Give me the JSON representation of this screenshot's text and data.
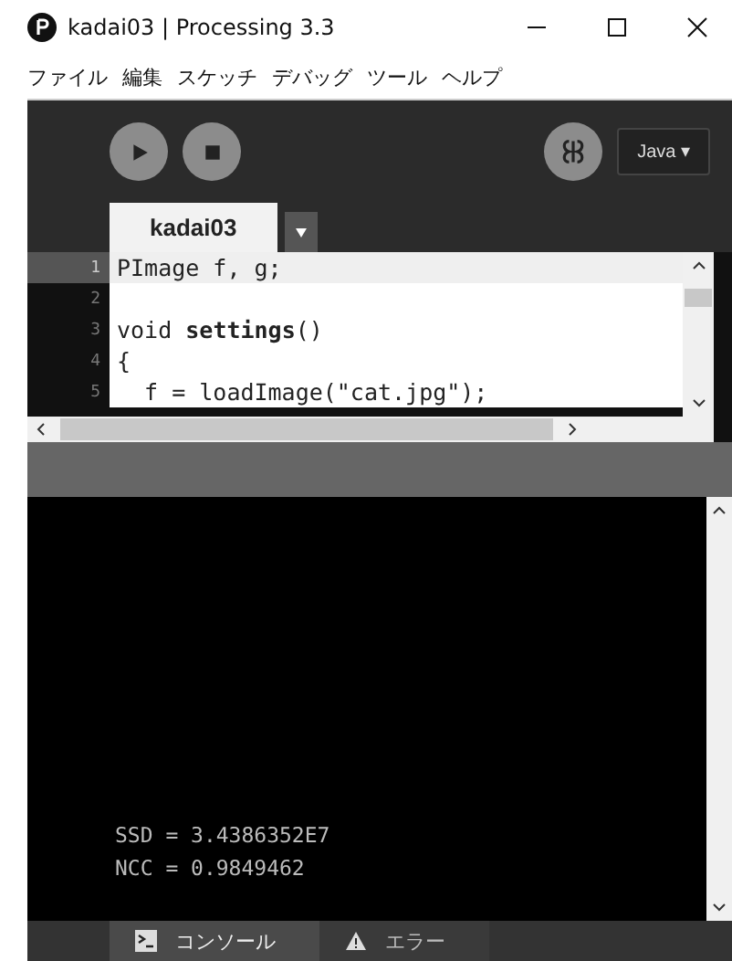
{
  "window": {
    "title": "kadai03 | Processing 3.3"
  },
  "menu": [
    "ファイル",
    "編集",
    "スケッチ",
    "デバッグ",
    "ツール",
    "ヘルプ"
  ],
  "toolbar": {
    "mode": "Java ▾"
  },
  "tabs": [
    {
      "label": "kadai03",
      "selected": true
    }
  ],
  "editor": {
    "lines": [
      {
        "number": "1",
        "text": "PImage f, g;",
        "current": true
      },
      {
        "number": "2",
        "current": false
      },
      {
        "number": "3",
        "text": "void **settings**()",
        "current": false
      },
      {
        "number": "4",
        "text": "{",
        "current": false
      },
      {
        "number": "5",
        "text": "  f = loadImage(\"cat.jpg\");",
        "current": false
      }
    ]
  },
  "console": {
    "lines": [
      "SSD = 3.4386352E7",
      "NCC = 0.9849462"
    ]
  },
  "bottom_tabs": [
    {
      "label": "コンソール",
      "kind": "console",
      "selected": true
    },
    {
      "label": "エラー",
      "kind": "errors",
      "selected": false
    }
  ]
}
